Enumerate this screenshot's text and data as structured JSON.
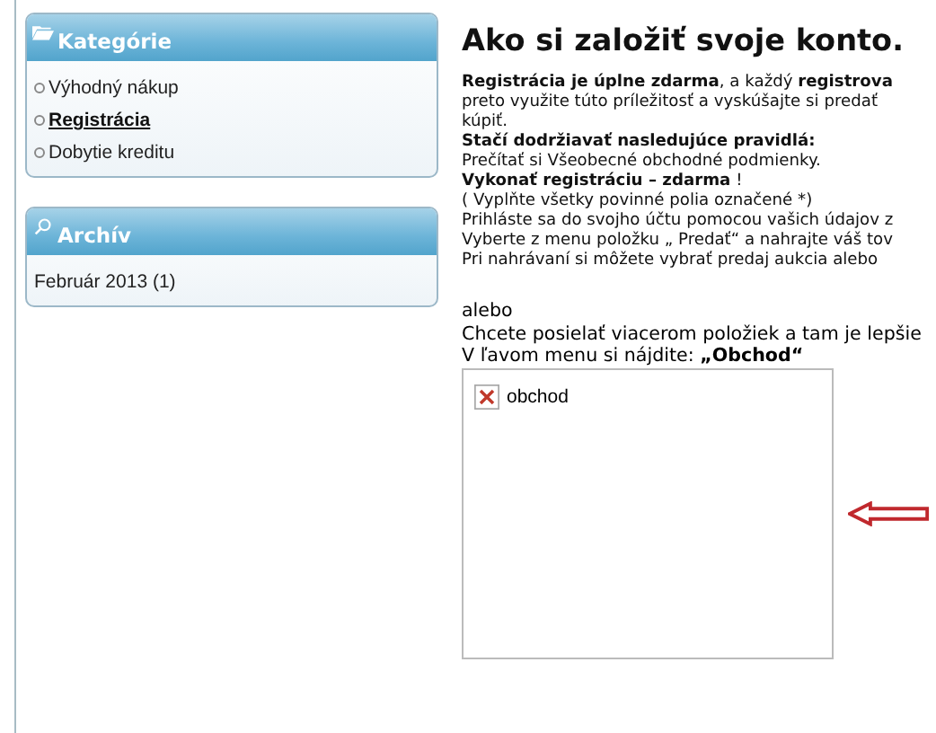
{
  "sidebar": [
    {
      "kind": "categories",
      "title": "Kategórie",
      "items": [
        {
          "label": "Výhodný nákup",
          "selected": false
        },
        {
          "label": "Registrácia",
          "selected": true
        },
        {
          "label": "Dobytie kreditu",
          "selected": false
        }
      ]
    },
    {
      "kind": "archive",
      "title": "Archív",
      "items": [
        {
          "label": "Február 2013 (1)",
          "selected": false
        }
      ]
    }
  ],
  "article": {
    "title": "Ako si založiť svoje konto.",
    "paragraphs": [
      "**Registrácia je úplne zdarma**, a každý **registrova**",
      "preto využite túto príležitosť a vyskúšajte si predať",
      "kúpiť.",
      "**Stačí dodržiavať nasledujúce pravidlá:**",
      "Prečítať si  Všeobecné obchodné podmienky.",
      "**Vykonať registráciu – zdarma** !",
      "( Vyplňte všetky povinné polia označené *)",
      "Prihláste sa do svojho účtu pomocou vašich údajov z",
      "Vyberte z menu položku „ Predať“ a nahrajte váš tov",
      "Pri nahrávaní si môžete vybrať predaj  aukcia alebo"
    ],
    "lines": [
      "alebo",
      "Chcete posielať viacerom položiek a tam je lepšie",
      "V ľavom menu si nájdite: **„Obchod“**"
    ],
    "image_alt": "obchod"
  }
}
